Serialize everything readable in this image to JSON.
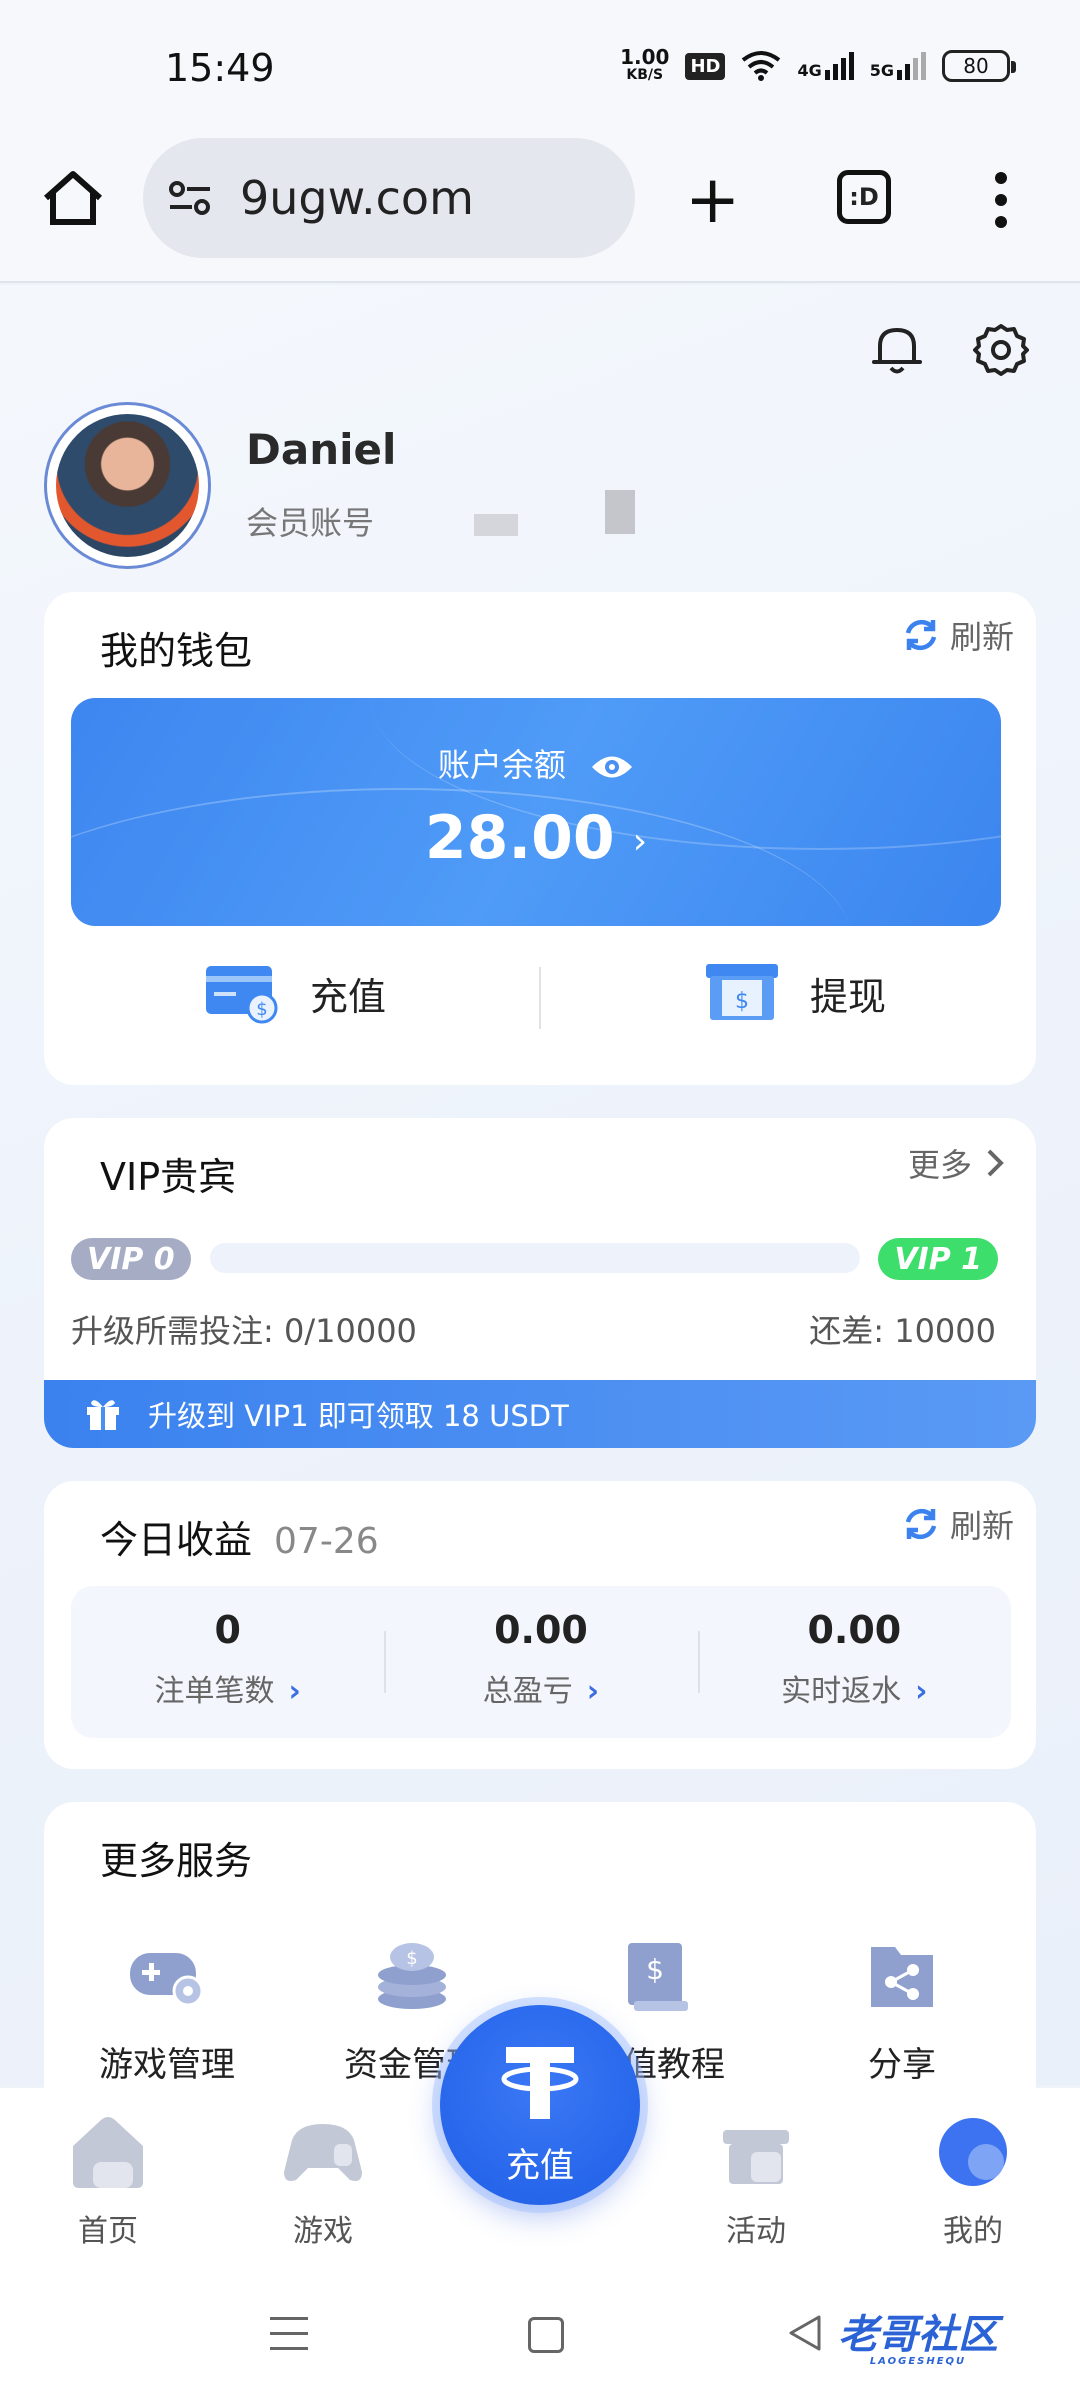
{
  "status_bar": {
    "time": "15:49",
    "net_speed": "1.00",
    "net_speed_unit": "KB/S",
    "hd_label": "HD",
    "signal_4g": "4G",
    "signal_5g": "5G",
    "battery": "80"
  },
  "browser": {
    "url": "9ugw.com",
    "tab_label": ":D"
  },
  "profile": {
    "username": "Daniel",
    "member_label": "会员账号"
  },
  "wallet": {
    "title": "我的钱包",
    "refresh_label": "刷新",
    "balance_label": "账户余额",
    "balance_value": "28.00",
    "deposit_label": "充值",
    "withdraw_label": "提现"
  },
  "vip": {
    "title": "VIP贵宾",
    "more_label": "更多",
    "current_level": "VIP 0",
    "next_level": "VIP 1",
    "progress_fraction": 0,
    "requirement_label": "升级所需投注:",
    "requirement_value": "0/10000",
    "difference_label": "还差:",
    "difference_value": "10000",
    "banner_text": "升级到 VIP1 即可领取 18 USDT"
  },
  "earnings": {
    "title": "今日收益",
    "date": "07-26",
    "refresh_label": "刷新",
    "stats": [
      {
        "value": "0",
        "label": "注单笔数"
      },
      {
        "value": "0.00",
        "label": "总盈亏"
      },
      {
        "value": "0.00",
        "label": "实时返水"
      }
    ]
  },
  "services": {
    "title": "更多服务",
    "items": [
      {
        "label": "游戏管理",
        "icon": "gamepad-gear-icon"
      },
      {
        "label": "资金管理",
        "icon": "coins-stack-icon"
      },
      {
        "label": "充值教程",
        "icon": "dollar-book-icon"
      },
      {
        "label": "分享",
        "icon": "share-folder-icon"
      }
    ]
  },
  "bottom_nav": {
    "items": [
      {
        "label": "首页",
        "icon": "home-icon"
      },
      {
        "label": "游戏",
        "icon": "gamepad-icon"
      },
      {
        "label": "活动",
        "icon": "gift-box-icon"
      },
      {
        "label": "我的",
        "icon": "profile-icon"
      }
    ],
    "center_label": "充值",
    "center_icon": "tether-icon"
  },
  "watermark": {
    "text": "老哥社区",
    "subtext": "LAOGESHEQU"
  },
  "colors": {
    "accent": "#3b82ef",
    "vip_current": "#a5acc4",
    "vip_next": "#3dde6b"
  }
}
